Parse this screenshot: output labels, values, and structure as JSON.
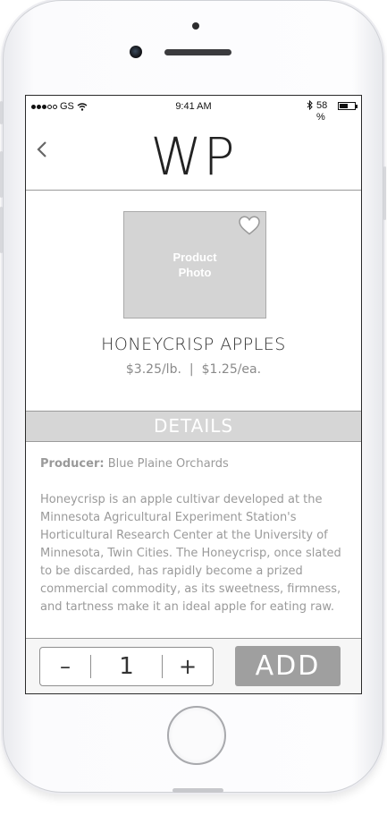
{
  "status_bar": {
    "carrier": "GS",
    "time": "9:41 AM",
    "battery_percent": "58\n%",
    "battery_level": 0.58,
    "signal_bars_filled": 3,
    "signal_bars_total": 5
  },
  "header": {
    "logo": "WP"
  },
  "product": {
    "photo_label": "Product\nPhoto",
    "name": "HONEYCRISP APPLES",
    "price_per_lb": "$3.25/lb.",
    "price_separator": "|",
    "price_each": "$1.25/ea."
  },
  "details": {
    "header": "DETAILS",
    "producer_label": "Producer:",
    "producer_value": "Blue Plaine Orchards",
    "description": "Honeycrisp is an apple cultivar developed at the Minnesota Agricultural Experiment Station's Horticultural Research Center at the University of Minnesota, Twin Cities. The Honeycrisp, once slated to be discarded, has rapidly become a prized commercial commodity, as its sweetness, firmness, and tartness make it an ideal apple for eating raw."
  },
  "cart": {
    "decrement_label": "–",
    "quantity": "1",
    "increment_label": "+",
    "add_label": "ADD"
  },
  "colors": {
    "details_bar": "#d6d6d6",
    "add_button": "#9f9f9f",
    "photo_placeholder": "#d4d4d4"
  }
}
